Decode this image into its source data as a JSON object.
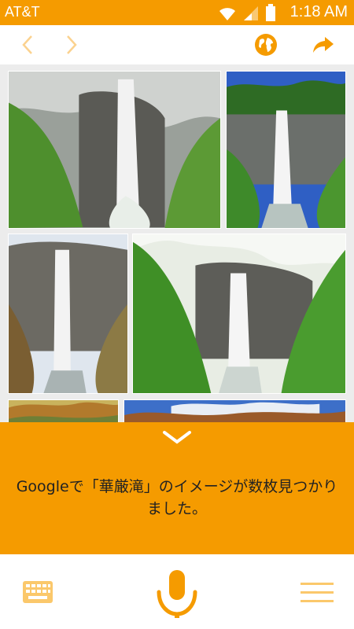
{
  "status_bar": {
    "carrier": "AT&T",
    "time": "1:18 AM",
    "icons": [
      "wifi-icon",
      "signal-icon",
      "battery-icon"
    ]
  },
  "toolbar": {
    "back_icon": "chevron-left-icon",
    "forward_icon": "chevron-right-icon",
    "globe_icon": "globe-icon",
    "share_icon": "share-icon"
  },
  "image_results": {
    "count_visible": 6,
    "subject": "waterfall photos"
  },
  "result_panel": {
    "collapse_icon": "chevron-down-icon",
    "message": "Googleで「華厳滝」のイメージが数枚見つかりました。"
  },
  "bottom_bar": {
    "keyboard_icon": "keyboard-icon",
    "mic_icon": "microphone-icon",
    "menu_icon": "menu-icon"
  },
  "colors": {
    "accent": "#f59b00",
    "accent_light": "#fbc86b"
  }
}
